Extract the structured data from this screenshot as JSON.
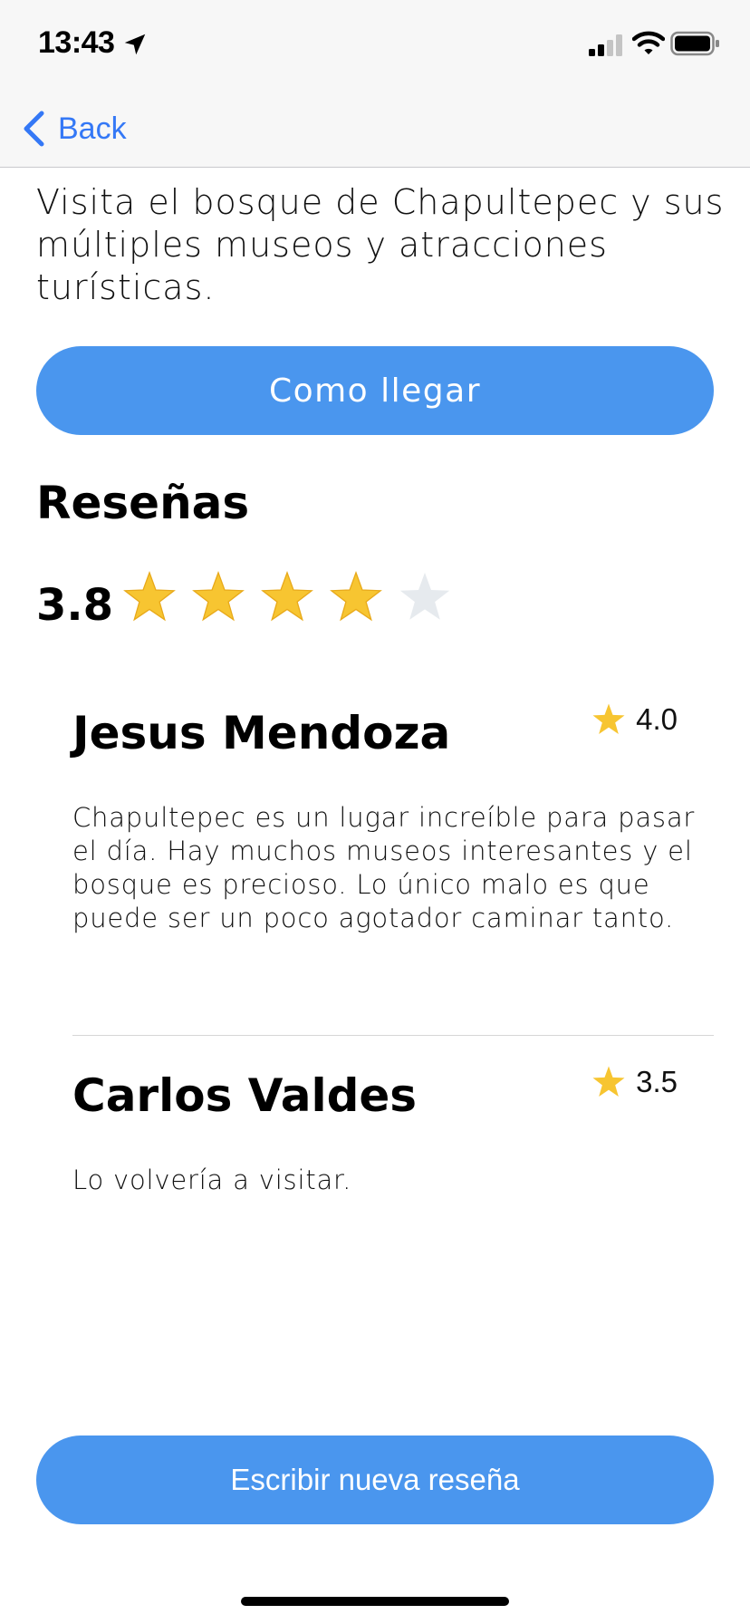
{
  "status_bar": {
    "time": "13:43",
    "icons": [
      "location-arrow-icon",
      "cellular-signal-icon",
      "wifi-icon",
      "battery-icon"
    ]
  },
  "nav": {
    "back_label": "Back",
    "back_icon": "chevron-left-icon"
  },
  "place": {
    "description": "Visita el bosque de Chapultepec y sus múltiples museos y atracciones turísticas.",
    "directions_label": "Como llegar"
  },
  "reviews_section": {
    "title": "Reseñas",
    "average": "3.8",
    "average_value": 3.8,
    "stars_filled": 4,
    "stars_total": 5,
    "star_color": "#f7c531",
    "star_empty_color": "#e6eaee"
  },
  "reviews": [
    {
      "author": "Jesus Mendoza",
      "score": "4.0",
      "body": "Chapultepec es un lugar increíble para pasar el día. Hay muchos museos interesantes y el bosque es precioso. Lo único malo es que puede ser un poco agotador caminar tanto."
    },
    {
      "author": "Carlos Valdes",
      "score": "3.5",
      "body": "Lo volvería a visitar."
    }
  ],
  "actions": {
    "new_review_label": "Escribir nueva reseña"
  },
  "colors": {
    "accent": "#4a96ee",
    "link": "#3478f6",
    "bar_background": "#f7f7f7"
  }
}
